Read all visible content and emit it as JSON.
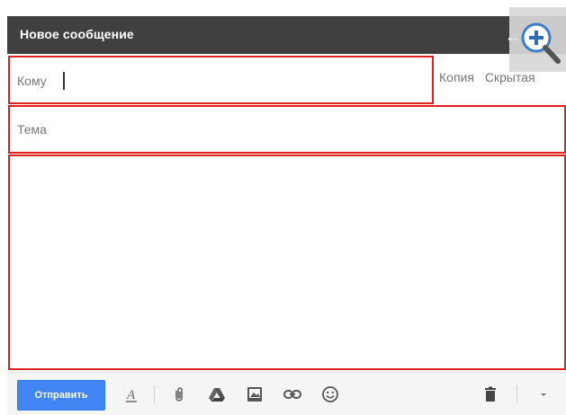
{
  "window": {
    "title": "Новое сообщение"
  },
  "fields": {
    "to_label": "Кому",
    "cc_label": "Копия",
    "bcc_label": "Скрытая",
    "subject_placeholder": "Тема"
  },
  "toolbar": {
    "send_label": "Отправить",
    "icons": [
      "format-text-icon",
      "attach-icon",
      "drive-icon",
      "insert-photo-icon",
      "insert-link-icon",
      "emoji-icon",
      "trash-icon",
      "more-options-icon"
    ]
  },
  "colors": {
    "titlebar": "#404040",
    "highlight_border": "#e0201e",
    "send_button": "#4285f4"
  }
}
